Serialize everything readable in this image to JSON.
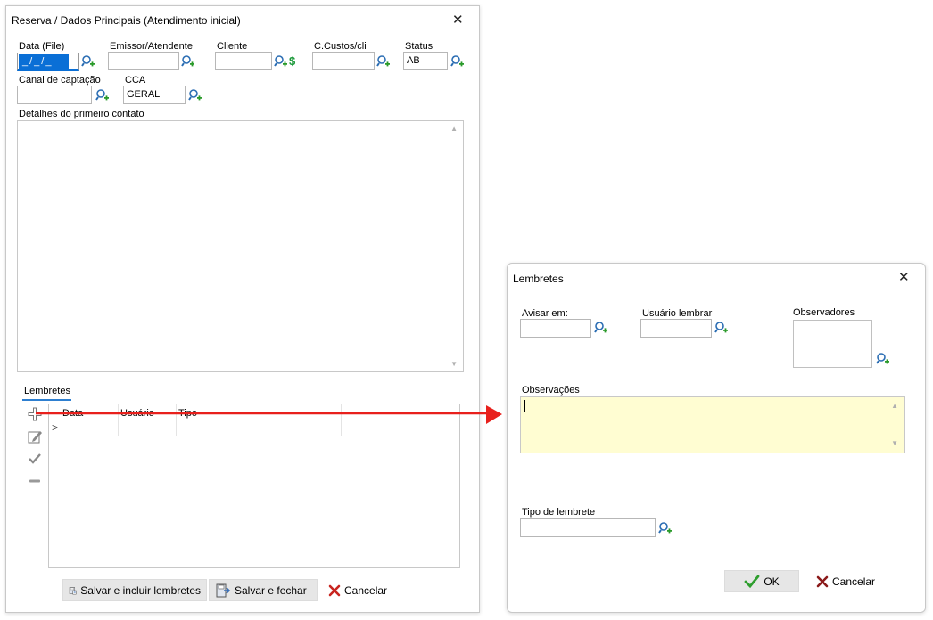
{
  "main_dialog": {
    "title": "Reserva / Dados Principais (Atendimento inicial)",
    "close_glyph": "✕",
    "fields": {
      "data_file": {
        "label": "Data (File)",
        "value": " _/_/_ "
      },
      "emissor": {
        "label": "Emissor/Atendente",
        "value": ""
      },
      "cliente": {
        "label": "Cliente",
        "value": "",
        "money_symbol": "$"
      },
      "ccustos": {
        "label": "C.Custos/cli",
        "value": ""
      },
      "status": {
        "label": "Status",
        "value": "AB"
      },
      "canal": {
        "label": "Canal de captação",
        "value": ""
      },
      "cca": {
        "label": "CCA",
        "value": "GERAL"
      }
    },
    "detalhes_label": "Detalhes do primeiro contato",
    "lembretes_tab": "Lembretes",
    "grid": {
      "columns": [
        "Data",
        "Usuário",
        "Tipo"
      ],
      "row_indicator": ">"
    },
    "buttons": {
      "save_include": "Salvar e incluir lembretes",
      "save_close": "Salvar e fechar",
      "cancel": "Cancelar"
    }
  },
  "reminder_dialog": {
    "title": "Lembretes",
    "close_glyph": "✕",
    "fields": {
      "avisar_em": {
        "label": "Avisar em:",
        "value": ""
      },
      "usuario_lembrar": {
        "label": "Usuário lembrar",
        "value": ""
      },
      "observadores": {
        "label": "Observadores"
      },
      "observacoes": {
        "label": "Observações",
        "value": ""
      },
      "tipo_lembrete": {
        "label": "Tipo de lembrete",
        "value": ""
      }
    },
    "buttons": {
      "ok": "OK",
      "cancel": "Cancelar"
    }
  },
  "colors": {
    "arrow": "#e8201c",
    "highlight": "#0a6fd6",
    "note_bg": "#fffdd2",
    "tab_underline": "#2e7fd0",
    "money": "#1e9a3c",
    "cancel_x": "#c8251f",
    "ok_check": "#2e9e2e"
  }
}
